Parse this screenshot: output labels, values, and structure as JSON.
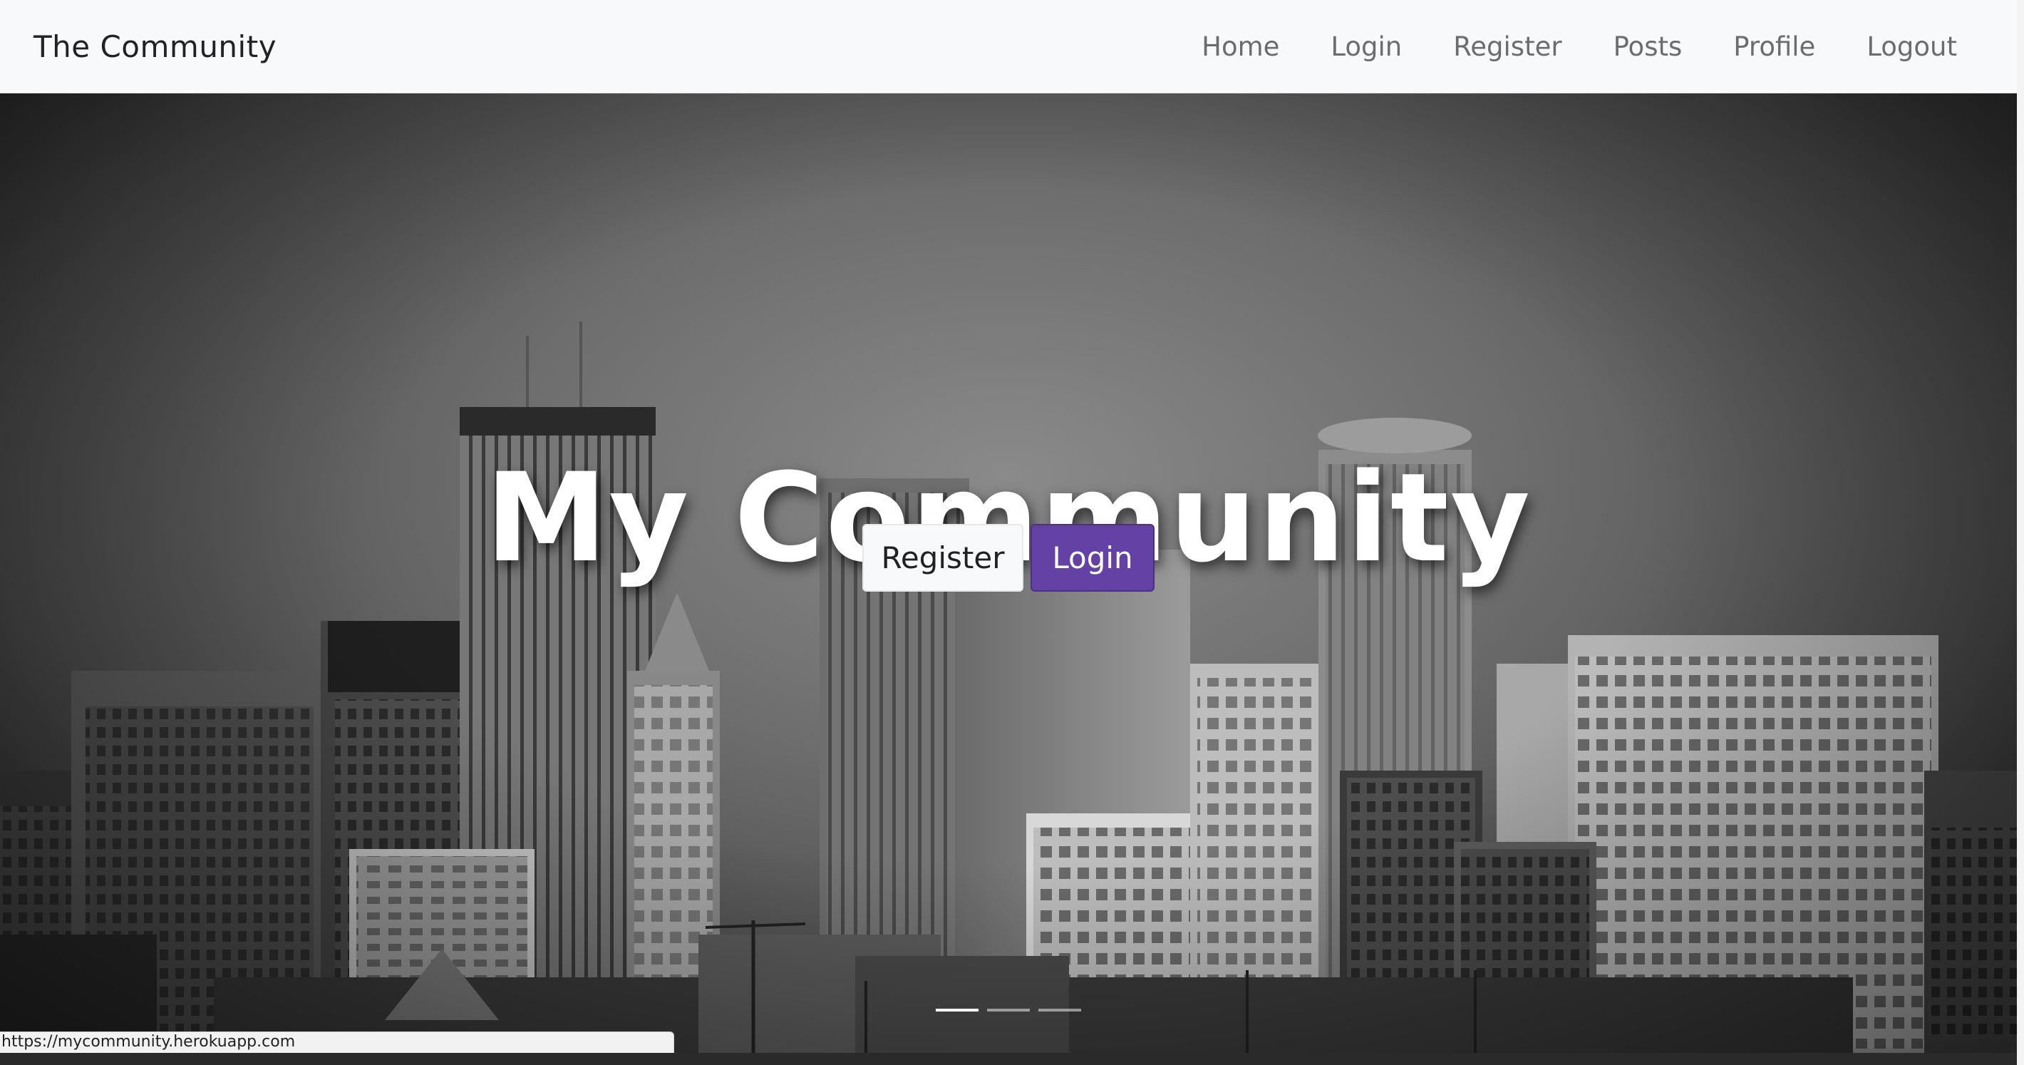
{
  "navbar": {
    "brand": "The Community",
    "links": [
      "Home",
      "Login",
      "Register",
      "Posts",
      "Profile",
      "Logout"
    ]
  },
  "hero": {
    "title": "My Community",
    "register_label": "Register",
    "login_label": "Login",
    "background": "grayscale city skyline photo",
    "carousel": {
      "slides": 3,
      "active_index": 0
    }
  },
  "status_bar": {
    "url": "https://mycommunity.herokuapp.com"
  },
  "colors": {
    "navbar_bg": "#f8f9fa",
    "primary_button": "#6441a4",
    "light_button": "#f8f9fa",
    "nav_link": "#6c6c6c"
  }
}
